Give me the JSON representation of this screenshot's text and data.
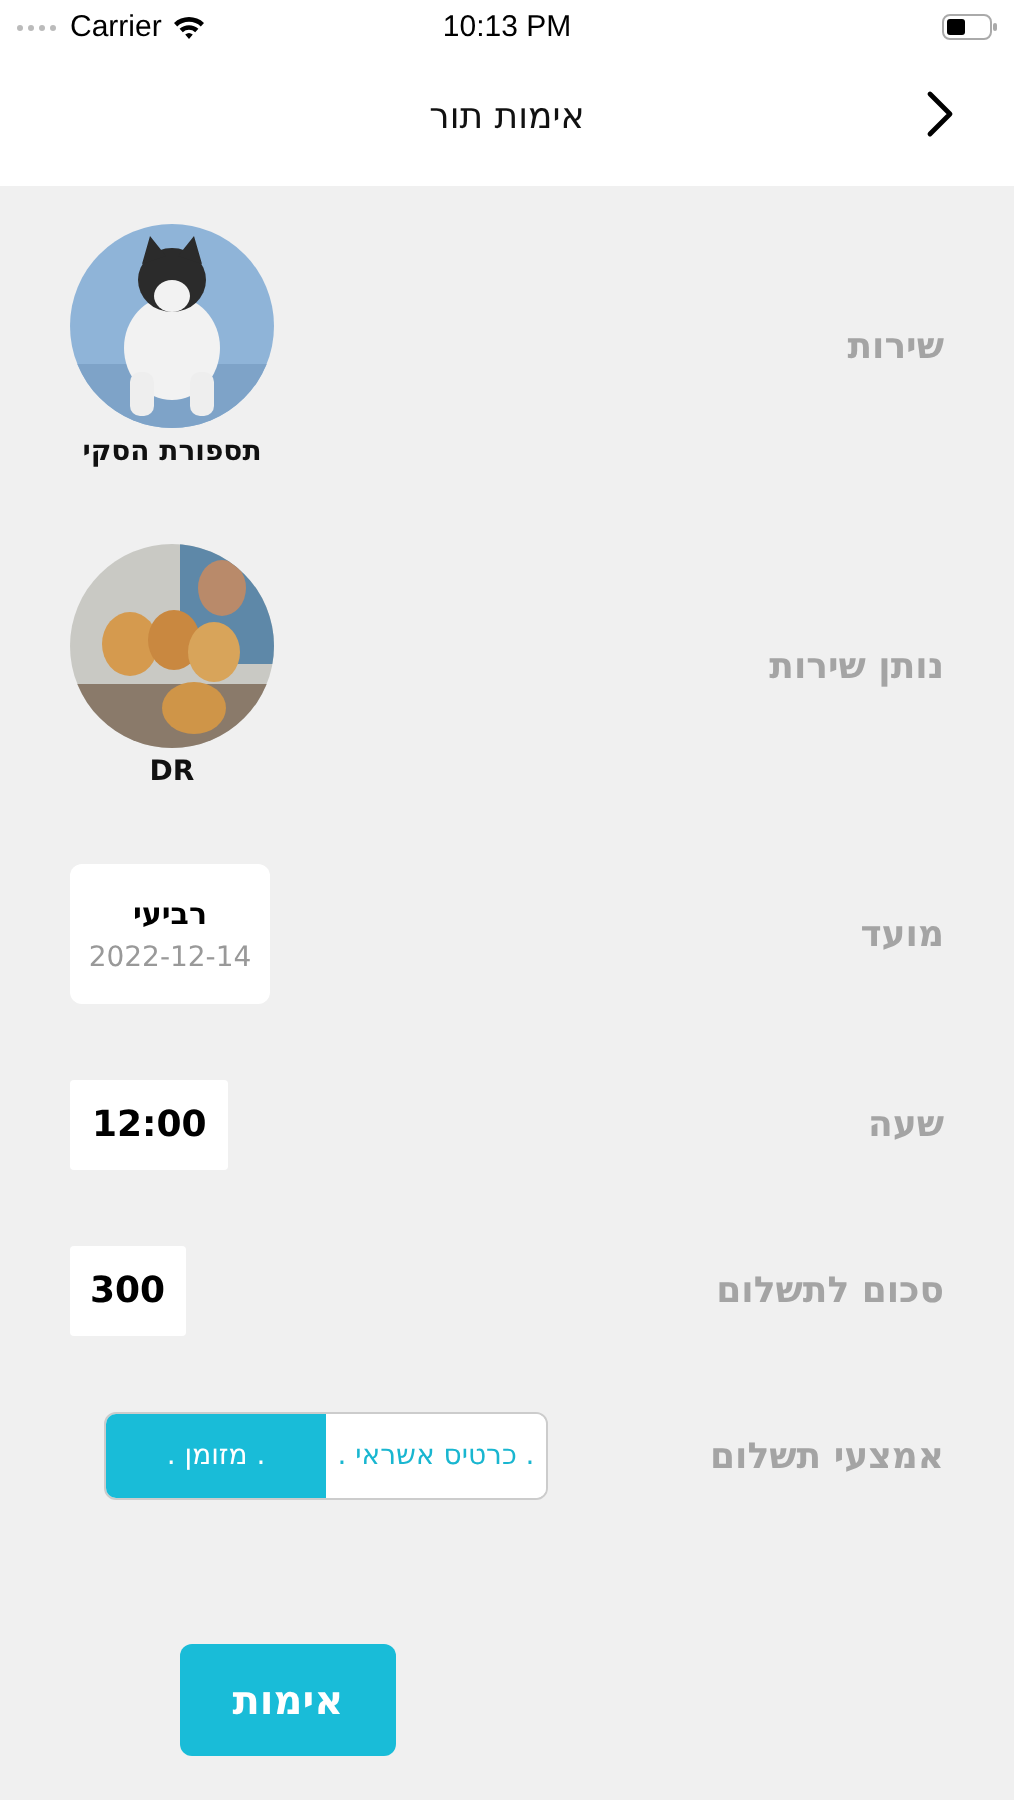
{
  "status_bar": {
    "carrier": "Carrier",
    "time": "10:13 PM"
  },
  "nav": {
    "title": "אימות תור"
  },
  "fields": [
    {
      "label": "שירות",
      "caption": "תספורת הסקי"
    },
    {
      "label": "נותן שירות",
      "caption": "DR"
    },
    {
      "kind": "date",
      "label": "מועד",
      "day": "רביעי",
      "date": "2022-12-14"
    },
    {
      "kind": "text",
      "label": "שעה",
      "value": "12:00"
    },
    {
      "kind": "text",
      "label": "סכום לתשלום",
      "value": "300"
    },
    {
      "kind": "payment",
      "label": "אמצעי תשלום",
      "options": [
        {
          "label": ". כרטיס אשראי .",
          "selected": false
        },
        {
          "label": ". מזומן .",
          "selected": true
        }
      ]
    }
  ],
  "confirm_button": "אימות"
}
